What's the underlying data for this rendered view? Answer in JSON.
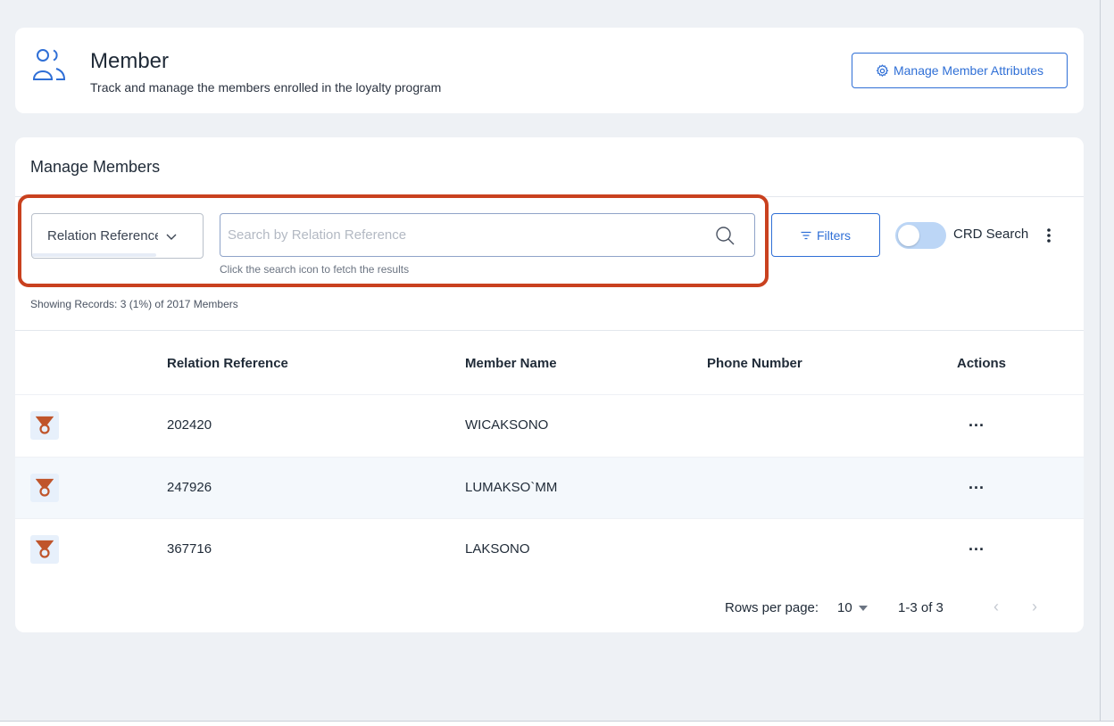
{
  "header": {
    "title": "Member",
    "subtitle": "Track and manage the members enrolled in the loyalty program",
    "manage_attributes_label": "Manage Member Attributes",
    "icon": "members-icon",
    "button_icon": "gear-icon"
  },
  "manage": {
    "title": "Manage Members",
    "search_by": {
      "selected": "Relation Reference",
      "icon": "chevron-down-icon"
    },
    "search": {
      "placeholder": "Search by Relation Reference",
      "value": "",
      "hint": "Click the search icon to fetch the results",
      "icon": "search-icon"
    },
    "filters_label": "Filters",
    "crd_search_label": "CRD Search",
    "crd_search_on": false,
    "records_text": "Showing Records: 3 (1%) of 2017 Members"
  },
  "table": {
    "columns": [
      "Relation Reference",
      "Member Name",
      "Phone Number",
      "Actions"
    ],
    "rows": [
      {
        "relation_reference": "202420",
        "member_name": "WICAKSONO",
        "phone_number": "",
        "actions": "..."
      },
      {
        "relation_reference": "247926",
        "member_name": "LUMAKSO`MM",
        "phone_number": "",
        "actions": "..."
      },
      {
        "relation_reference": "367716",
        "member_name": "LAKSONO",
        "phone_number": "",
        "actions": "..."
      }
    ]
  },
  "pagination": {
    "rows_per_page_label": "Rows per page:",
    "rows_per_page": "10",
    "range": "1-3 of 3",
    "prev": "‹",
    "next": "›"
  },
  "colors": {
    "accent": "#2f6fd6",
    "highlight": "#c9411f",
    "badge_icon": "#c0552b"
  }
}
